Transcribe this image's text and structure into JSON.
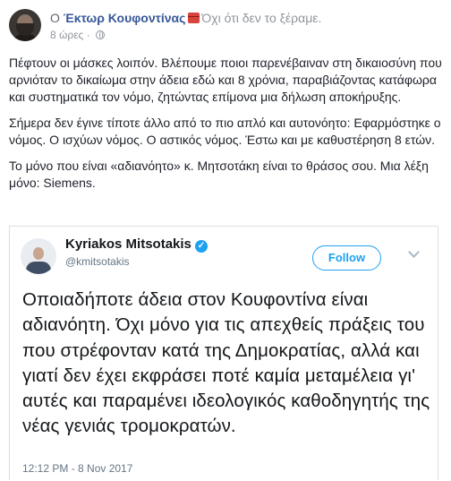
{
  "post": {
    "prefix": "Ο",
    "author": "Έκτωρ Κουφοντίνας",
    "feeling": "Όχι ότι δεν το ξέραμε.",
    "time": "8 ώρες",
    "time_separator": "·",
    "paragraphs": [
      "Πέφτουν οι μάσκες λοιπόν. Βλέπουμε ποιοι παρενέβαιναν στη δικαιοσύνη που αρνιόταν το δικαίωμα στην άδεια εδώ και 8 χρόνια, παραβιάζοντας κατάφωρα και συστηματικά τον νόμο, ζητώντας επίμονα μια δήλωση αποκήρυξης.",
      "Σήμερα δεν έγινε τίποτε άλλο από το πιο απλό και αυτονόητο: Εφαρμόστηκε ο νόμος. Ο ισχύων νόμος. Ο αστικός νόμος. Έστω και με καθυστέρηση 8 ετών.",
      "Το μόνο που είναι «αδιανόητο» κ. Μητσοτάκη είναι το θράσος σου. Μια λέξη μόνο: Siemens."
    ],
    "icons": [
      "avatar",
      "red-box-emoji-icon",
      "globe-icon"
    ]
  },
  "tweet": {
    "name": "Kyriakos Mitsotakis",
    "handle": "@kmitsotakis",
    "follow_label": "Follow",
    "text": "Οποιαδήποτε άδεια στον Κουφοντίνα είναι αδιανόητη. Όχι μόνο για τις απεχθείς πράξεις του που στρέφονταν κατά της Δημοκρατίας, αλλά και γιατί δεν έχει εκφράσει ποτέ καμία μεταμέλεια γι' αυτές και παραμένει ιδεολογικός καθοδηγητής της νέας γενιάς τρομοκρατών.",
    "timestamp": "12:12 PM - 8 Nov 2017",
    "verified_glyph": "✓",
    "accent_color": "#1da1f2"
  },
  "colors": {
    "author_link": "#385898",
    "muted_text": "#90949c",
    "body_text": "#1d2129"
  }
}
